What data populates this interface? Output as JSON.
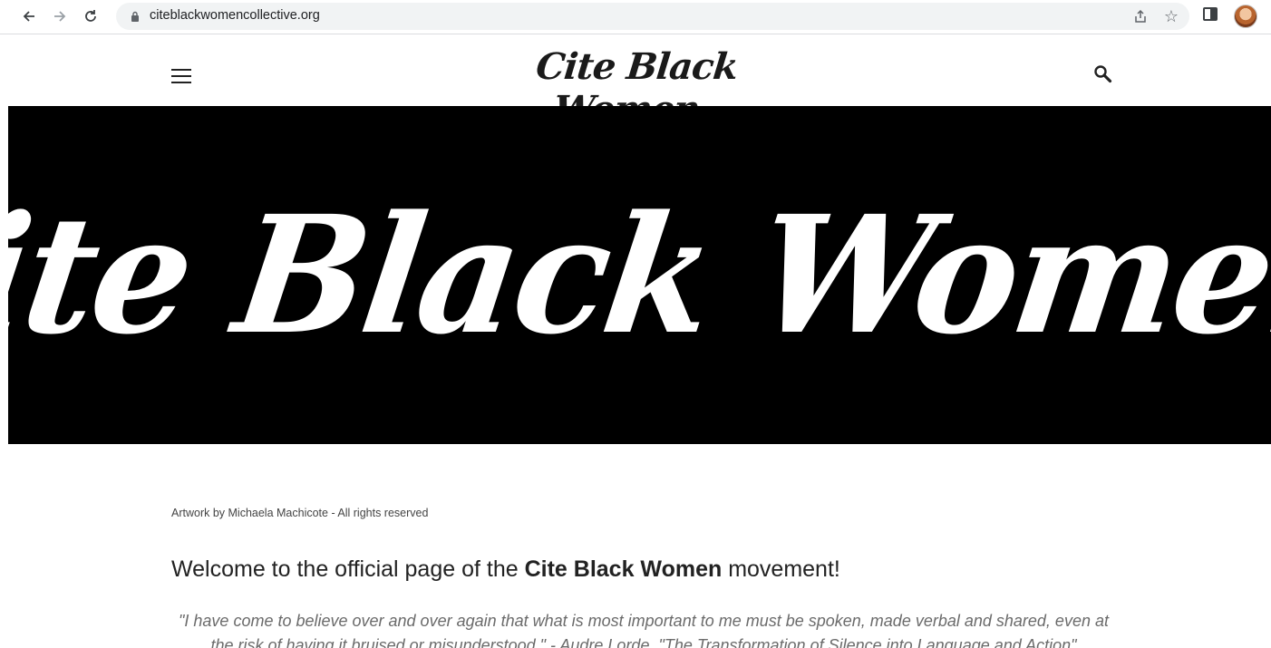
{
  "browser": {
    "url": "citeblackwomencollective.org",
    "back_icon": "arrow-left-icon",
    "forward_icon": "arrow-right-icon",
    "reload_icon": "reload-icon",
    "lock_icon": "lock-icon",
    "share_icon": "share-icon",
    "star_icon": "star-icon",
    "sidepanel_icon": "side-panel-icon"
  },
  "header": {
    "logo_text": "Cite Black Women.",
    "menu_icon": "hamburger-menu-icon",
    "search_icon": "search-icon"
  },
  "hero": {
    "banner_text": "Cite Black Women.",
    "background": "#000000",
    "text_color": "#ffffff"
  },
  "content": {
    "caption": "Artwork by Michaela Machicote - All rights reserved",
    "welcome_prefix": "Welcome to the official page of the ",
    "welcome_bold": "Cite Black Women",
    "welcome_suffix": " movement!",
    "quote": "\"I have come to believe over and over again that what is most important to me must be spoken, made verbal and shared, even at the risk of having it bruised or misunderstood.\" - Audre Lorde, \"The Transformation of Silence into Language and Action\""
  }
}
